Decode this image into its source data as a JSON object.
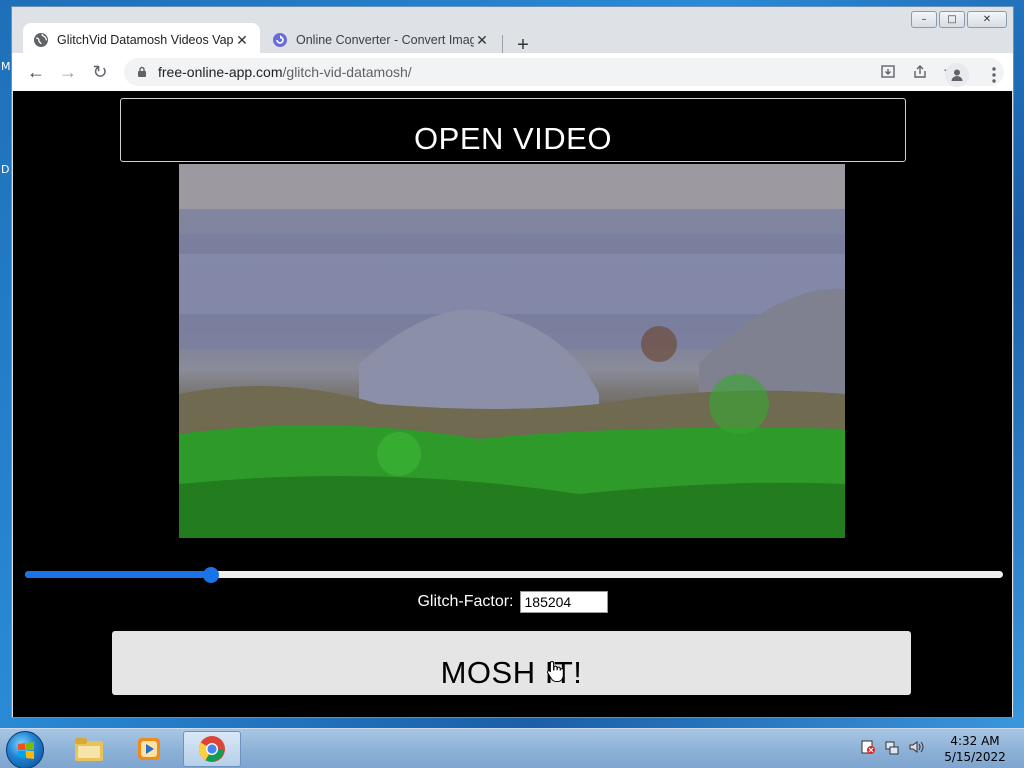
{
  "desktop": {
    "side_text_top": "M",
    "side_text_mid": "D"
  },
  "window": {
    "controls": {
      "minimize": "–",
      "maximize": "□",
      "close": "✕"
    }
  },
  "tabs": [
    {
      "title": "GlitchVid Datamosh Videos Vapo",
      "close": "✕"
    },
    {
      "title": "Online Converter - Convert Imag",
      "close": "✕"
    }
  ],
  "new_tab": "+",
  "toolbar": {
    "back": "←",
    "forward": "→",
    "reload": "↻",
    "url_host": "free-online-app.com",
    "url_path": "/glitch-vid-datamosh/"
  },
  "page": {
    "open_video_label": "OPEN VIDEO",
    "slider": {
      "value_fraction": 0.19
    },
    "glitch_label": "Glitch-Factor:",
    "glitch_value": "185204",
    "mosh_label": "MOSH IT!"
  },
  "taskbar": {
    "time": "4:32 AM",
    "date": "5/15/2022"
  }
}
